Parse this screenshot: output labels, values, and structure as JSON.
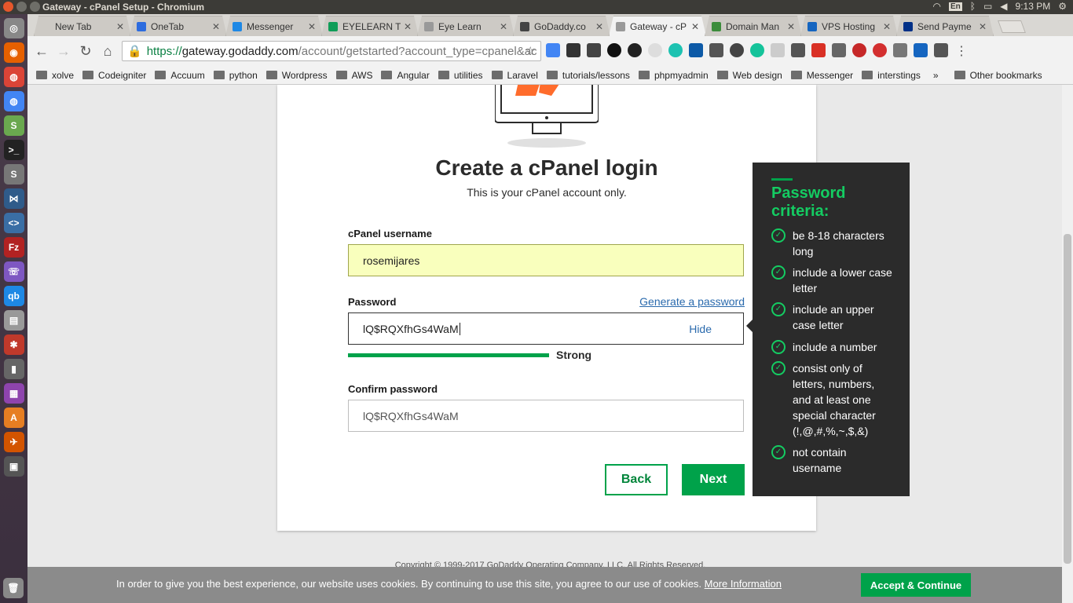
{
  "system": {
    "window_title": "Gateway - cPanel Setup - Chromium",
    "lang": "En",
    "clock": "9:13 PM"
  },
  "tabs": [
    {
      "label": "New Tab",
      "icon": "newtab-icon",
      "color": "#cdcac5"
    },
    {
      "label": "OneTab",
      "icon": "onetab-icon",
      "color": "#2d6cdf"
    },
    {
      "label": "Messenger",
      "icon": "messenger-icon",
      "color": "#1e88e5"
    },
    {
      "label": "EYELEARN T",
      "icon": "sheets-icon",
      "color": "#0f9d58"
    },
    {
      "label": "Eye Learn",
      "icon": "page-icon",
      "color": "#999999"
    },
    {
      "label": "GoDaddy.co",
      "icon": "godaddy-icon",
      "color": "#444444"
    },
    {
      "label": "Gateway - cP",
      "icon": "page-icon",
      "color": "#999999"
    },
    {
      "label": "Domain Man",
      "icon": "domain-icon",
      "color": "#3b8c3b"
    },
    {
      "label": "VPS Hosting",
      "icon": "vps-icon",
      "color": "#1565c0"
    },
    {
      "label": "Send Payme",
      "icon": "paypal-icon",
      "color": "#003087"
    }
  ],
  "address": {
    "scheme": "https://",
    "host": "gateway.godaddy.com",
    "path": "/account/getstarted?account_type=cpanel&ac"
  },
  "bookmarks": [
    {
      "label": "xolve"
    },
    {
      "label": "Codeigniter"
    },
    {
      "label": "Accuum"
    },
    {
      "label": "python"
    },
    {
      "label": "Wordpress"
    },
    {
      "label": "AWS"
    },
    {
      "label": "Angular"
    },
    {
      "label": "utilities"
    },
    {
      "label": "Laravel"
    },
    {
      "label": "tutorials/lessons"
    },
    {
      "label": "phpmyadmin"
    },
    {
      "label": "Web design"
    },
    {
      "label": "Messenger"
    },
    {
      "label": "interstings"
    }
  ],
  "bookmarks_more": "»",
  "bookmarks_other": "Other bookmarks",
  "form": {
    "heading": "Create a cPanel login",
    "subheading": "This is your cPanel account only.",
    "username_label": "cPanel username",
    "username_value": "rosemijares",
    "password_label": "Password",
    "generate_link": "Generate a password",
    "password_value": "lQ$RQXfhGs4WaM",
    "hide_label": "Hide",
    "strength_label": "Strong",
    "strength_fraction": 1.0,
    "confirm_label": "Confirm password",
    "confirm_value": "lQ$RQXfhGs4WaM",
    "back_label": "Back",
    "next_label": "Next"
  },
  "criteria": {
    "title": "Password criteria:",
    "items": [
      "be 8-18 characters long",
      "include a lower case letter",
      "include an upper case letter",
      "include a number",
      "consist only of letters, numbers, and at least one special character (!,@,#,%,~,$,&)",
      "not contain username"
    ]
  },
  "footer": {
    "copyright": "Copyright © 1999-2017 GoDaddy Operating Company, LLC. All Rights Reserved."
  },
  "cookie": {
    "message": "In order to give you the best experience, our website uses cookies. By continuing to use this site, you agree to our use of cookies.",
    "more_link": "More Information",
    "accept_label": "Accept & Continue"
  },
  "colors": {
    "brand_green": "#00a24a",
    "criteria_green": "#14cc62",
    "criteria_bg": "#2b2b2b",
    "autofill_yellow": "#f9ffbd"
  }
}
